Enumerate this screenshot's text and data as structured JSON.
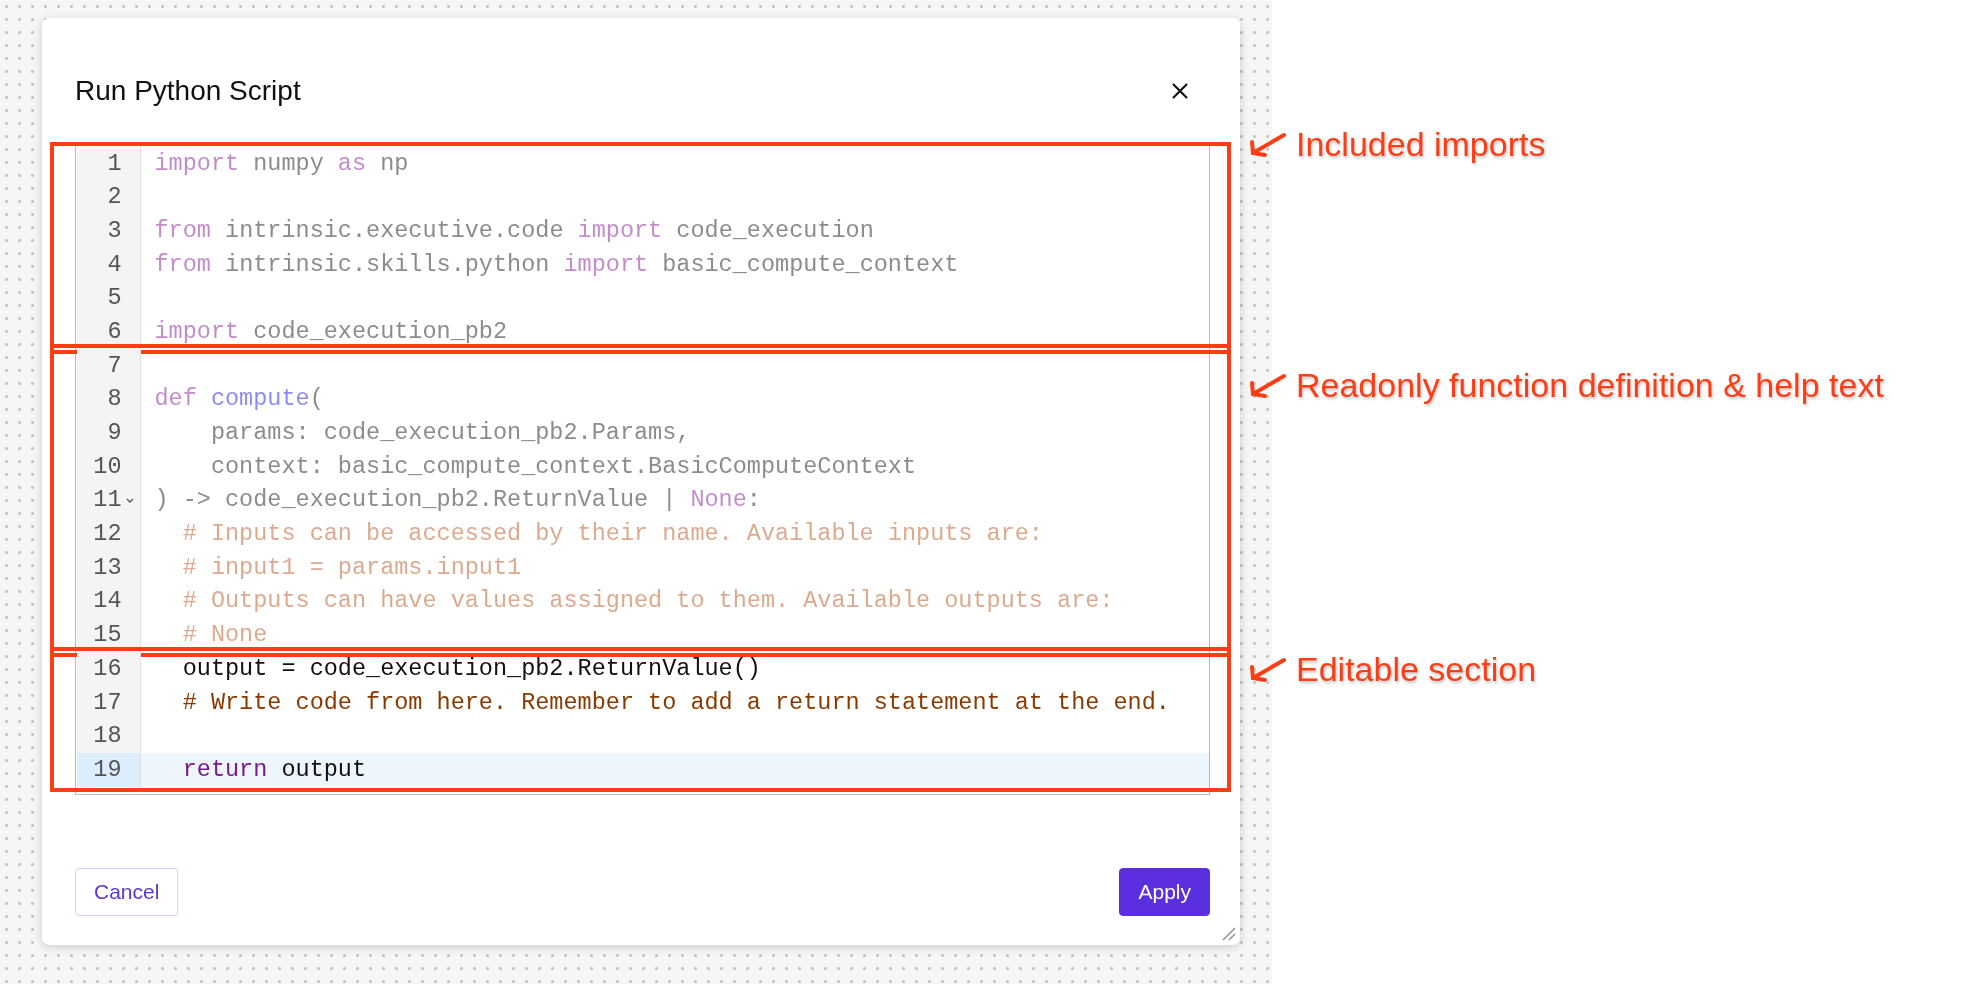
{
  "dialog": {
    "title": "Run Python Script"
  },
  "editor": {
    "sections": [
      {
        "annotation": "Included imports",
        "lines": [
          {
            "number": "1",
            "readonly": true,
            "highlighted": false,
            "foldable": false,
            "tokens": [
              {
                "kind": "keyword",
                "text": "import"
              },
              {
                "kind": "plain",
                "text": " numpy "
              },
              {
                "kind": "keyword",
                "text": "as"
              },
              {
                "kind": "plain",
                "text": " np"
              }
            ]
          },
          {
            "number": "2",
            "highlighted": false,
            "foldable": false
          },
          {
            "number": "3",
            "readonly": true,
            "highlighted": false,
            "foldable": false,
            "tokens": [
              {
                "kind": "keyword",
                "text": "from"
              },
              {
                "kind": "plain",
                "text": " intrinsic.executive.code "
              },
              {
                "kind": "keyword",
                "text": "import"
              },
              {
                "kind": "plain",
                "text": " code_execution"
              }
            ]
          },
          {
            "number": "4",
            "readonly": true,
            "highlighted": false,
            "foldable": false,
            "tokens": [
              {
                "kind": "keyword",
                "text": "from"
              },
              {
                "kind": "plain",
                "text": " intrinsic.skills.python "
              },
              {
                "kind": "keyword",
                "text": "import"
              },
              {
                "kind": "plain",
                "text": " basic_compute_context"
              }
            ]
          },
          {
            "number": "5",
            "highlighted": false,
            "foldable": false
          },
          {
            "number": "6",
            "readonly": true,
            "highlighted": false,
            "foldable": false,
            "tokens": [
              {
                "kind": "keyword",
                "text": "import"
              },
              {
                "kind": "plain",
                "text": " code_execution_pb2"
              }
            ]
          }
        ]
      },
      {
        "annotation": "Readonly function definition & help text",
        "lines": [
          {
            "number": "7",
            "highlighted": false,
            "foldable": false
          },
          {
            "number": "8",
            "readonly": true,
            "highlighted": false,
            "foldable": false,
            "tokens": [
              {
                "kind": "keyword",
                "text": "def"
              },
              {
                "kind": "name",
                "text": " compute"
              },
              {
                "kind": "plain",
                "text": "("
              }
            ]
          },
          {
            "number": "9",
            "readonly": true,
            "highlighted": false,
            "foldable": false,
            "tokens": [
              {
                "kind": "plain",
                "text": "    params: code_execution_pb2.Params,"
              }
            ]
          },
          {
            "number": "10",
            "readonly": true,
            "highlighted": false,
            "foldable": false,
            "tokens": [
              {
                "kind": "plain",
                "text": "    context: basic_compute_context.BasicComputeContext"
              }
            ]
          },
          {
            "number": "11",
            "readonly": true,
            "highlighted": false,
            "foldable": true,
            "tokens": [
              {
                "kind": "plain",
                "text": ") -> code_execution_pb2.ReturnValue | "
              },
              {
                "kind": "keyword",
                "text": "None"
              },
              {
                "kind": "plain",
                "text": ":"
              }
            ]
          },
          {
            "number": "12",
            "readonly": true,
            "highlighted": false,
            "foldable": false,
            "tokens": [
              {
                "kind": "comment",
                "text": "  # Inputs can be accessed by their name. Available inputs are:"
              }
            ]
          },
          {
            "number": "13",
            "readonly": true,
            "highlighted": false,
            "foldable": false,
            "tokens": [
              {
                "kind": "comment",
                "text": "  # input1 = params.input1"
              }
            ]
          },
          {
            "number": "14",
            "readonly": true,
            "highlighted": false,
            "foldable": false,
            "tokens": [
              {
                "kind": "comment",
                "text": "  # Outputs can have values assigned to them. Available outputs are:"
              }
            ]
          },
          {
            "number": "15",
            "readonly": true,
            "highlighted": false,
            "foldable": false,
            "tokens": [
              {
                "kind": "comment",
                "text": "  # None"
              }
            ]
          }
        ]
      },
      {
        "annotation": "Editable section",
        "lines": [
          {
            "number": "16",
            "readonly": false,
            "highlighted": false,
            "foldable": false,
            "tokens": [
              {
                "kind": "plain",
                "text": "  output = code_execution_pb2.ReturnValue()"
              }
            ]
          },
          {
            "number": "17",
            "readonly": false,
            "highlighted": false,
            "foldable": false,
            "tokens": [
              {
                "kind": "comment",
                "text": "  # Write code from here. Remember to add a return statement at the end."
              }
            ]
          },
          {
            "number": "18",
            "highlighted": false,
            "foldable": false
          },
          {
            "number": "19",
            "readonly": false,
            "highlighted": true,
            "foldable": false,
            "tokens": [
              {
                "kind": "keyword",
                "text": "  return"
              },
              {
                "kind": "plain",
                "text": " output"
              }
            ]
          }
        ]
      }
    ]
  },
  "buttons": [
    {
      "label": "Cancel",
      "kind": "secondary"
    },
    {
      "label": "Apply",
      "kind": "primary"
    }
  ]
}
